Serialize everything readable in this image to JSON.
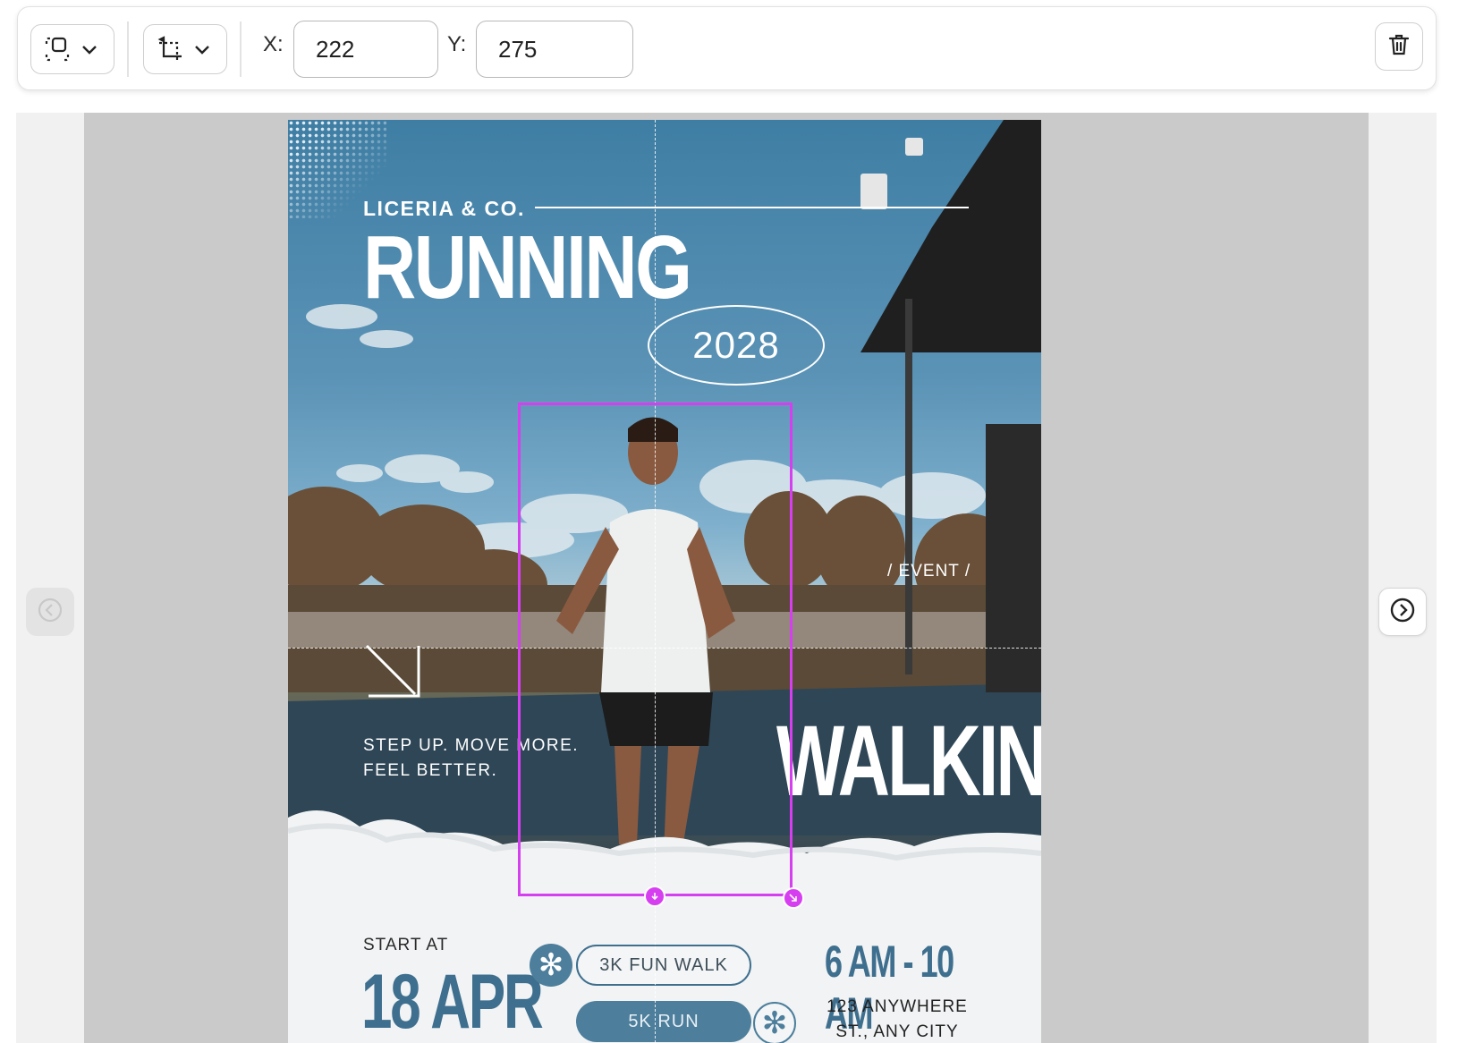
{
  "toolbar": {
    "position_tool_icon": "frame-select-icon",
    "transform_tool_icon": "crop-rotate-icon",
    "x_label": "X:",
    "x_value": "222",
    "y_label": "Y:",
    "y_value": "275",
    "delete_icon": "trash-icon"
  },
  "navigation": {
    "prev_icon": "chevron-left-circle-icon",
    "next_icon": "chevron-right-circle-icon"
  },
  "poster": {
    "brand": "LICERIA & CO.",
    "title_top": "RUNNING",
    "year": "2028",
    "event_label": "/ EVENT /",
    "tagline_line1": "STEP UP. MOVE MORE.",
    "tagline_line2": "FEEL BETTER.",
    "title_bottom": "WALKING",
    "start_label": "START AT",
    "date": "18 APR",
    "option1": "3K FUN WALK",
    "option2": "5K RUN",
    "time": "6 AM - 10 AM",
    "address_line1": "123 ANYWHERE",
    "address_line2": "ST., ANY CITY"
  },
  "colors": {
    "selection": "#d63ff0",
    "accent_blue": "#4d7e9c"
  }
}
